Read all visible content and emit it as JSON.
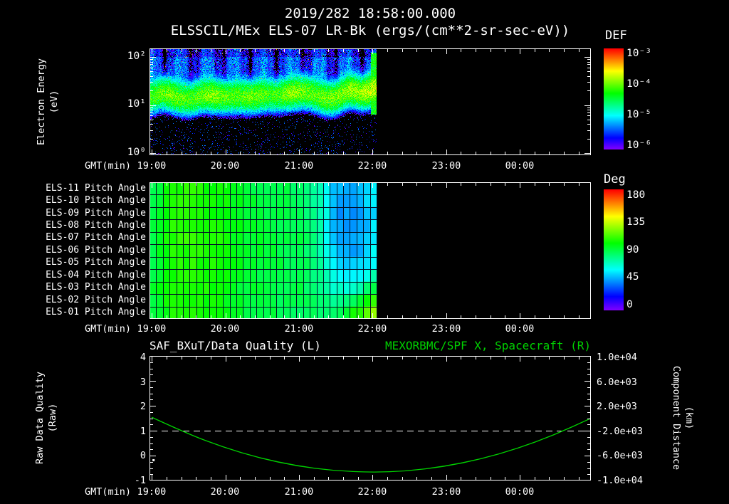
{
  "header": {
    "date": "2019/282 18:58:00.000",
    "title": "ELSSCIL/MEx ELS-07 LR-Bk (ergs/(cm**2-sr-sec-eV))"
  },
  "colors": {
    "background": "#000000",
    "text": "#ffffff",
    "accent_green": "#00d000",
    "colormap": "rainbow"
  },
  "xaxis": {
    "label": "GMT(min)",
    "ticks": [
      "19:00",
      "20:00",
      "21:00",
      "22:00",
      "23:00",
      "00:00"
    ],
    "start": "18:58",
    "end": "00:58"
  },
  "panel1": {
    "ylabel1": "Electron Energy",
    "ylabel2": "(eV)",
    "yticks": [
      "10²",
      "10¹",
      "10⁰"
    ],
    "colorbar": {
      "title": "DEF",
      "ticks": [
        "10⁻³",
        "10⁻⁴",
        "10⁻⁵",
        "10⁻⁶"
      ]
    }
  },
  "panel2": {
    "row_labels": [
      "ELS-11 Pitch Angle",
      "ELS-10 Pitch Angle",
      "ELS-09 Pitch Angle",
      "ELS-08 Pitch Angle",
      "ELS-07 Pitch Angle",
      "ELS-06 Pitch Angle",
      "ELS-05 Pitch Angle",
      "ELS-04 Pitch Angle",
      "ELS-03 Pitch Angle",
      "ELS-02 Pitch Angle",
      "ELS-01 Pitch Angle"
    ],
    "colorbar": {
      "title": "Deg",
      "ticks": [
        "180",
        "135",
        "90",
        "45",
        "0"
      ]
    }
  },
  "panel3": {
    "title_left": "SAF_BXuT/Data Quality (L)",
    "title_right": "MEXORBMC/SPF X, Spacecraft (R)",
    "yticks_left": [
      "4",
      "3",
      "2",
      "1",
      "0",
      "-1"
    ],
    "yticks_right": [
      "1.0e+04",
      "6.0e+03",
      "2.0e+03",
      "-2.0e+03",
      "-6.0e+03",
      "-1.0e+04"
    ],
    "ylabel_left1": "Raw Data Quality",
    "ylabel_left2": "(Raw)",
    "ylabel_right1": "Component Distance",
    "ylabel_right2": "(km)"
  },
  "chart_data": [
    {
      "type": "heatmap",
      "title": "ELSSCIL/MEx ELS-07 LR-Bk",
      "units": "ergs/(cm**2-sr-sec-eV)",
      "xlabel": "GMT(min)",
      "ylabel": "Electron Energy (eV)",
      "x_start": "18:58",
      "x_end": "00:58",
      "data_end": "22:03",
      "y_scale": "log",
      "y_range_eV": [
        1,
        150
      ],
      "colorbar": {
        "label": "DEF",
        "scale": "log",
        "min": 1e-06,
        "max": 0.001
      },
      "model": {
        "band_center_eV": [
          12,
          18,
          13,
          20,
          14,
          17,
          13,
          19,
          15,
          17,
          20,
          26
        ],
        "band_peak": [
          6e-05,
          9e-05,
          6.5e-05,
          0.0001,
          7e-05,
          8.5e-05,
          6e-05,
          0.0001,
          7.5e-05,
          9e-05,
          0.00011,
          0.00016
        ],
        "bg_above_band": 4.5e-06,
        "band_sigma_decades": 0.15
      }
    },
    {
      "type": "heatmap",
      "rows": [
        "ELS-11",
        "ELS-10",
        "ELS-09",
        "ELS-08",
        "ELS-07",
        "ELS-06",
        "ELS-05",
        "ELS-04",
        "ELS-03",
        "ELS-02",
        "ELS-01"
      ],
      "x_start": "18:58",
      "data_end": "22:03",
      "colorbar": {
        "label": "Deg",
        "min": 0,
        "max": 180
      },
      "time_cols": [
        "19:00",
        "19:15",
        "19:30",
        "19:45",
        "20:00",
        "20:15",
        "20:30",
        "20:45",
        "21:00",
        "21:15",
        "21:30",
        "21:45",
        "22:00"
      ],
      "values_deg": [
        [
          88,
          104,
          106,
          103,
          99,
          92,
          90,
          88,
          86,
          76,
          48,
          46,
          60
        ],
        [
          88,
          105,
          107,
          104,
          100,
          93,
          91,
          89,
          86,
          74,
          46,
          44,
          58
        ],
        [
          89,
          105,
          106,
          104,
          100,
          93,
          91,
          89,
          87,
          74,
          45,
          44,
          56
        ],
        [
          89,
          106,
          107,
          104,
          100,
          94,
          92,
          90,
          87,
          75,
          45,
          43,
          55
        ],
        [
          90,
          106,
          107,
          105,
          101,
          94,
          92,
          90,
          88,
          76,
          46,
          44,
          56
        ],
        [
          90,
          105,
          106,
          104,
          100,
          94,
          92,
          90,
          88,
          77,
          48,
          46,
          58
        ],
        [
          90,
          105,
          106,
          104,
          100,
          93,
          91,
          89,
          88,
          78,
          52,
          50,
          62
        ],
        [
          91,
          104,
          105,
          103,
          99,
          93,
          91,
          89,
          88,
          80,
          58,
          56,
          70
        ],
        [
          91,
          104,
          105,
          103,
          98,
          92,
          90,
          89,
          88,
          82,
          66,
          68,
          88
        ],
        [
          91,
          103,
          104,
          102,
          97,
          92,
          90,
          88,
          87,
          84,
          74,
          84,
          106
        ],
        [
          92,
          102,
          103,
          101,
          96,
          91,
          89,
          88,
          87,
          85,
          86,
          102,
          122
        ]
      ]
    },
    {
      "type": "line",
      "title_left": "SAF_BXuT/Data Quality (L)",
      "title_right": "MEXORBMC/SPF X, Spacecraft (R)",
      "x_start": "18:58",
      "x_end": "00:58",
      "left_axis": {
        "label": "Raw Data Quality (Raw)",
        "range": [
          -1,
          4
        ]
      },
      "right_axis": {
        "label": "Component Distance (km)",
        "range": [
          -10000,
          10000
        ]
      },
      "series": [
        {
          "name": "SAF_BXuT/Data Quality",
          "axis": "left",
          "style": "dashed",
          "color": "#ffffff",
          "value": 1
        },
        {
          "name": "MEXORBMC/SPF X Spacecraft",
          "axis": "right",
          "style": "solid",
          "color": "#00d000",
          "points_h_km": [
            [
              0.03,
              170
            ],
            [
              0.5,
              -2400
            ],
            [
              1.0,
              -4640
            ],
            [
              1.5,
              -6400
            ],
            [
              2.0,
              -7660
            ],
            [
              2.5,
              -8420
            ],
            [
              3.03,
              -8700
            ],
            [
              3.5,
              -8480
            ],
            [
              4.0,
              -7770
            ],
            [
              4.5,
              -6570
            ],
            [
              5.0,
              -4880
            ],
            [
              5.5,
              -2690
            ],
            [
              6.0,
              -10
            ]
          ]
        }
      ],
      "marker": {
        "h": 0.05,
        "left_value": -0.17,
        "color": "#ffffff"
      }
    }
  ]
}
